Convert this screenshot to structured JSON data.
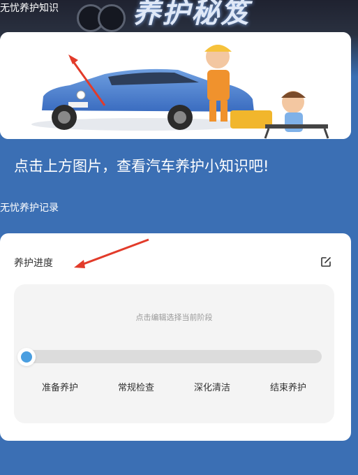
{
  "hero": {
    "knowledge_label": "无忧养护知识",
    "title_art": "养护秘笈"
  },
  "banner": {
    "tap_hint": "点击上方图片，查看汽车养护小知识吧!"
  },
  "records": {
    "label": "无忧养护记录"
  },
  "progress": {
    "title": "养护进度",
    "hint": "点击编辑选择当前阶段",
    "current_stage_fraction": 0,
    "stages": [
      "准备养护",
      "常规检查",
      "深化清洁",
      "结束养护"
    ]
  },
  "colors": {
    "page_bg": "#3b6fb4",
    "slider_accent": "#4a9ee0",
    "annotation_arrow": "#e23b2a"
  },
  "icons": {
    "edit": "edit-square-icon"
  }
}
